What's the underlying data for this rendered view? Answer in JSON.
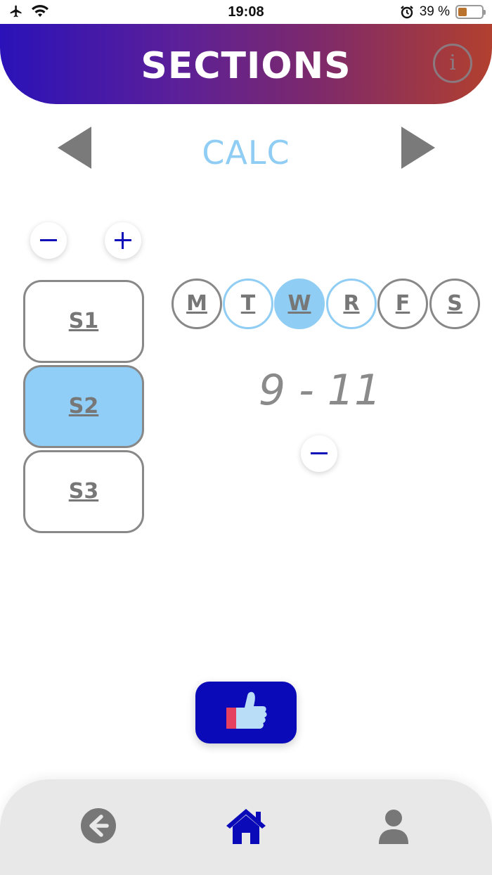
{
  "status_bar": {
    "time": "19:08",
    "battery_text": "39 %",
    "battery_level_percent": 39,
    "battery_color": "#b9732e"
  },
  "header": {
    "title": "SECTIONS",
    "info_icon": "info-icon",
    "info_glyph": "i"
  },
  "course": {
    "name": "CALC",
    "prev_icon": "triangle-left-icon",
    "next_icon": "triangle-right-icon"
  },
  "sections": {
    "items": [
      {
        "label": "S1",
        "selected": false
      },
      {
        "label": "S2",
        "selected": true
      },
      {
        "label": "S3",
        "selected": false
      }
    ]
  },
  "days": [
    {
      "label": "M",
      "state": "off"
    },
    {
      "label": "T",
      "state": "partial"
    },
    {
      "label": "W",
      "state": "on"
    },
    {
      "label": "R",
      "state": "partial"
    },
    {
      "label": "F",
      "state": "off"
    },
    {
      "label": "S",
      "state": "off"
    }
  ],
  "time_range": "9 - 11",
  "colors": {
    "accent_blue": "#90cdf4",
    "primary_navy": "#0a0ab8",
    "thumb_red": "#e64060"
  },
  "nav": {
    "back_icon": "back-arrow-icon",
    "home_icon": "home-icon",
    "profile_icon": "user-icon",
    "active": "home"
  }
}
